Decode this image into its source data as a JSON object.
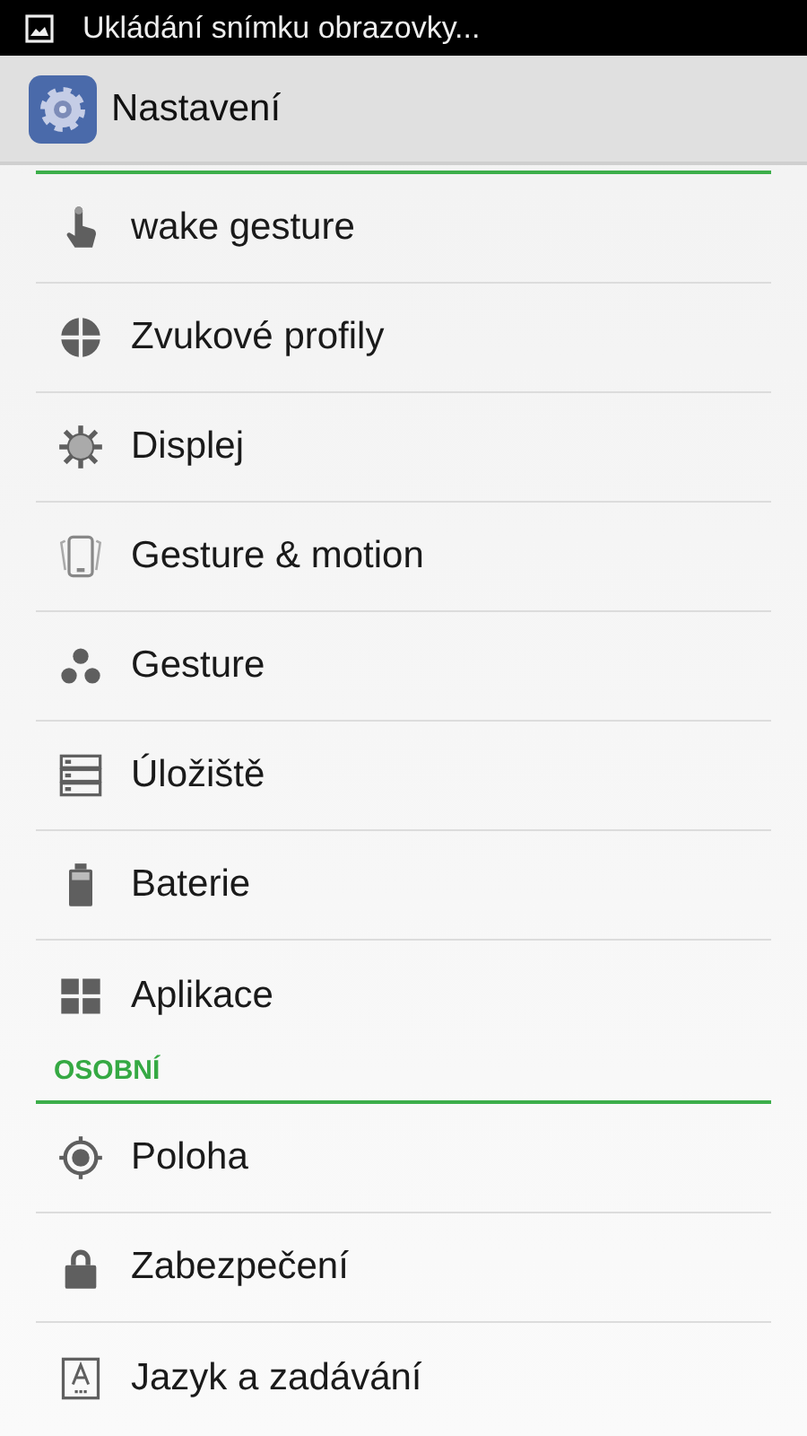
{
  "status_bar": {
    "notification": "Ukládání snímku obrazovky..."
  },
  "action_bar": {
    "title": "Nastavení"
  },
  "sections": [
    {
      "items": [
        {
          "label": "wake gesture"
        },
        {
          "label": "Zvukové profily"
        },
        {
          "label": "Displej"
        },
        {
          "label": "Gesture & motion"
        },
        {
          "label": "Gesture"
        },
        {
          "label": "Úložiště"
        },
        {
          "label": "Baterie"
        },
        {
          "label": "Aplikace"
        }
      ]
    },
    {
      "header": "OSOBNÍ",
      "items": [
        {
          "label": "Poloha"
        },
        {
          "label": "Zabezpečení"
        },
        {
          "label": "Jazyk a zadávání"
        }
      ]
    }
  ]
}
